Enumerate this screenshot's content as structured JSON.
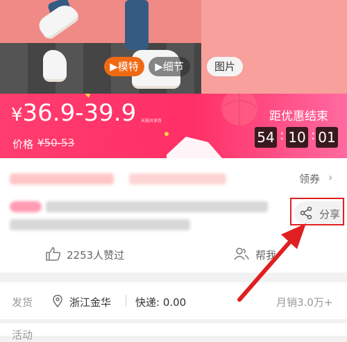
{
  "gallery": {
    "tabs": [
      {
        "label": "▶模特"
      },
      {
        "label": "▶细节"
      },
      {
        "label": "图片"
      }
    ]
  },
  "promo": {
    "currency": "¥",
    "price_range": "36.9-39.9",
    "small_tag": "天猫共享券",
    "orig_label": "价格",
    "orig_price": "¥50-53",
    "countdown_title": "距优惠结束",
    "countdown": [
      "54",
      "10",
      "01"
    ],
    "colors": {
      "start": "#ff3d6e",
      "end": "#ff6aa0"
    }
  },
  "coupon": {
    "label": "领券"
  },
  "share": {
    "label": "分享",
    "icon": "share-icon",
    "highlight_color": "#e02020"
  },
  "social": {
    "likes": "2253人赞过",
    "help": "帮我"
  },
  "shipping": {
    "label": "发货",
    "location": "浙江金华",
    "express": "快递: 0.00",
    "monthly_sales": "月销3.0万+"
  },
  "activity": {
    "label": "活动"
  }
}
